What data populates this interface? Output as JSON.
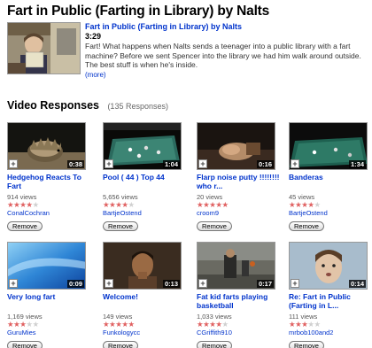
{
  "page": {
    "title": "Fart in Public (Farting in Library) by Nalts"
  },
  "main_video": {
    "title": "Fart in Public (Farting in Library) by Nalts",
    "duration": "3:29",
    "description": "Fart! What happens when Nalts sends a teenager into a public library with a fart machine? Before we sent Spencer into the library we had him walk around outside. The best stuff is when he's inside.",
    "more_label": "(more)"
  },
  "responses": {
    "heading": "Video Responses",
    "count": "(135 Responses)",
    "remove_label": "Remove",
    "add_symbol": "+",
    "items": [
      {
        "title": "Hedgehog Reacts To Fart",
        "duration": "0:38",
        "views": "914 views",
        "rating": 4,
        "user": "ConalCochran"
      },
      {
        "title": "Pool ( 44 ) Top 44",
        "duration": "1:04",
        "views": "5,656 views",
        "rating": 4,
        "user": "BartjeOstend"
      },
      {
        "title": "Flarp noise putty !!!!!!!! who r...",
        "duration": "0:16",
        "views": "20 views",
        "rating": 5,
        "user": "croom9"
      },
      {
        "title": "Banderas",
        "duration": "1:34",
        "views": "45 views",
        "rating": 4,
        "user": "BartjeOstend"
      },
      {
        "title": "Very long fart",
        "duration": "0:09",
        "views": "1,169 views",
        "rating": 3,
        "user": "GuruMies"
      },
      {
        "title": "Welcome!",
        "duration": "0:13",
        "views": "149 views",
        "rating": 5,
        "user": "Funkologycc"
      },
      {
        "title": "Fat kid farts playing basketball",
        "duration": "0:17",
        "views": "1,033 views",
        "rating": 4,
        "user": "CGriffith910"
      },
      {
        "title": "Re: Fart in Public (Farting in L...",
        "duration": "0:14",
        "views": "111 views",
        "rating": 3,
        "user": "mrbob100and2"
      }
    ]
  }
}
